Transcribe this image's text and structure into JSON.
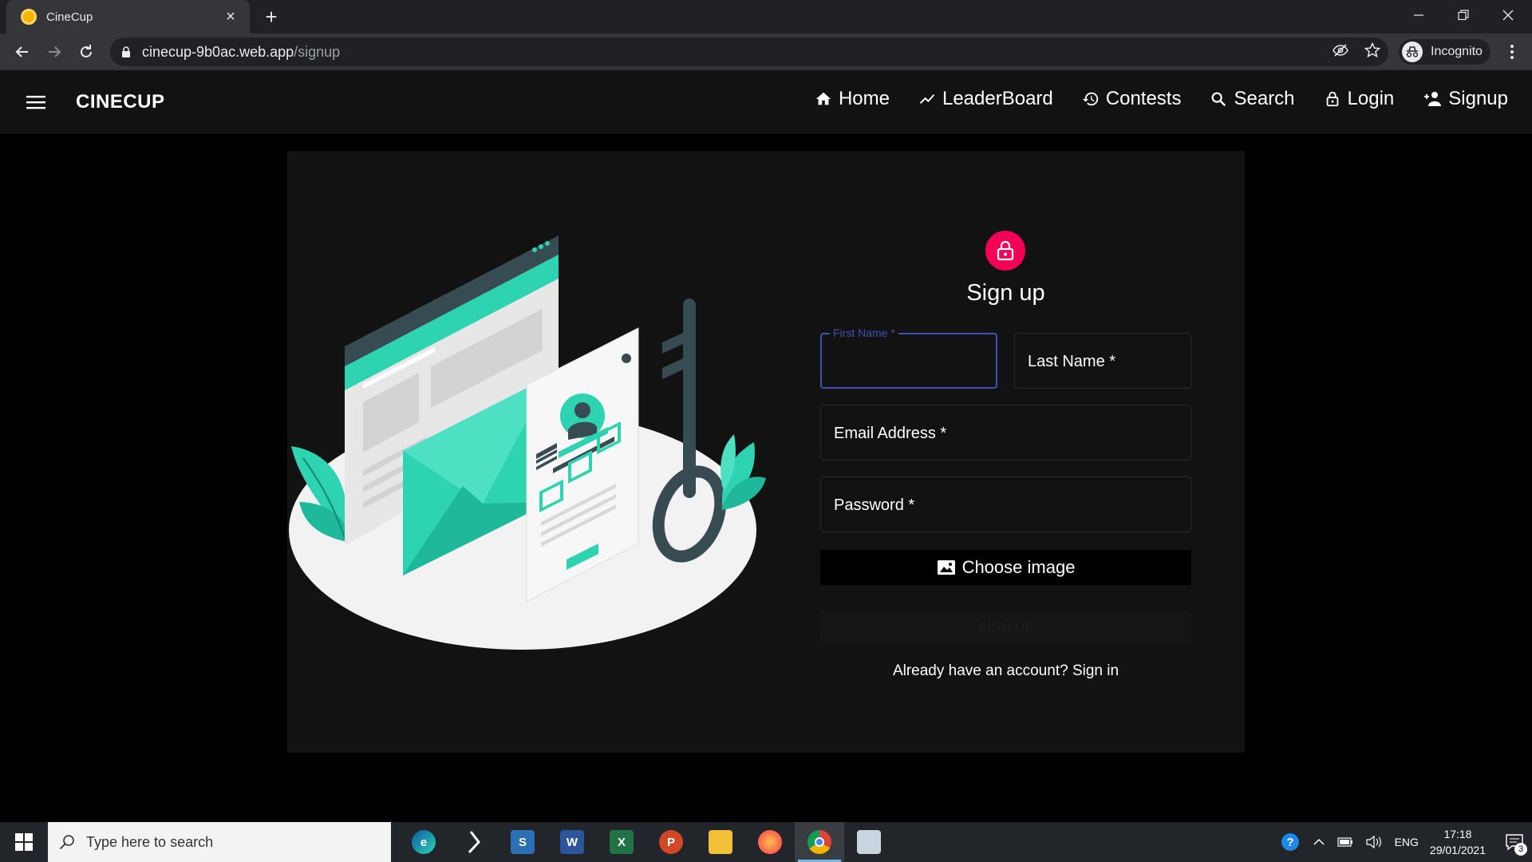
{
  "browser": {
    "tab_title": "CineCup",
    "url_host": "cinecup-9b0ac.web.app",
    "url_path": "/signup",
    "profile_label": "Incognito"
  },
  "app": {
    "brand": "CINECUP",
    "nav": [
      {
        "label": "Home",
        "icon": "home-icon"
      },
      {
        "label": "LeaderBoard",
        "icon": "trending-up-icon"
      },
      {
        "label": "Contests",
        "icon": "history-icon"
      },
      {
        "label": "Search",
        "icon": "search-icon"
      },
      {
        "label": "Login",
        "icon": "lock-icon"
      },
      {
        "label": "Signup",
        "icon": "person-add-icon"
      }
    ]
  },
  "form": {
    "title": "Sign up",
    "first_name_label": "First Name *",
    "last_name_label": "Last Name *",
    "email_label": "Email Address *",
    "password_label": "Password *",
    "choose_image_label": "Choose image",
    "submit_label": "SIGN UP",
    "signin_link": "Already have an account? Sign in"
  },
  "taskbar": {
    "search_placeholder": "Type here to search",
    "language": "ENG",
    "time": "17:18",
    "date": "29/01/2021",
    "notification_count": "3",
    "apps": [
      "edge-icon",
      "vscode-icon",
      "scan-icon",
      "word-icon",
      "excel-icon",
      "powerpoint-icon",
      "file-explorer-icon",
      "firefox-icon",
      "chrome-icon",
      "snipping-icon"
    ]
  },
  "colors": {
    "accent_pink": "#f50057",
    "focus_blue": "#3f51b5",
    "illustration_teal": "#2ed3b1"
  }
}
